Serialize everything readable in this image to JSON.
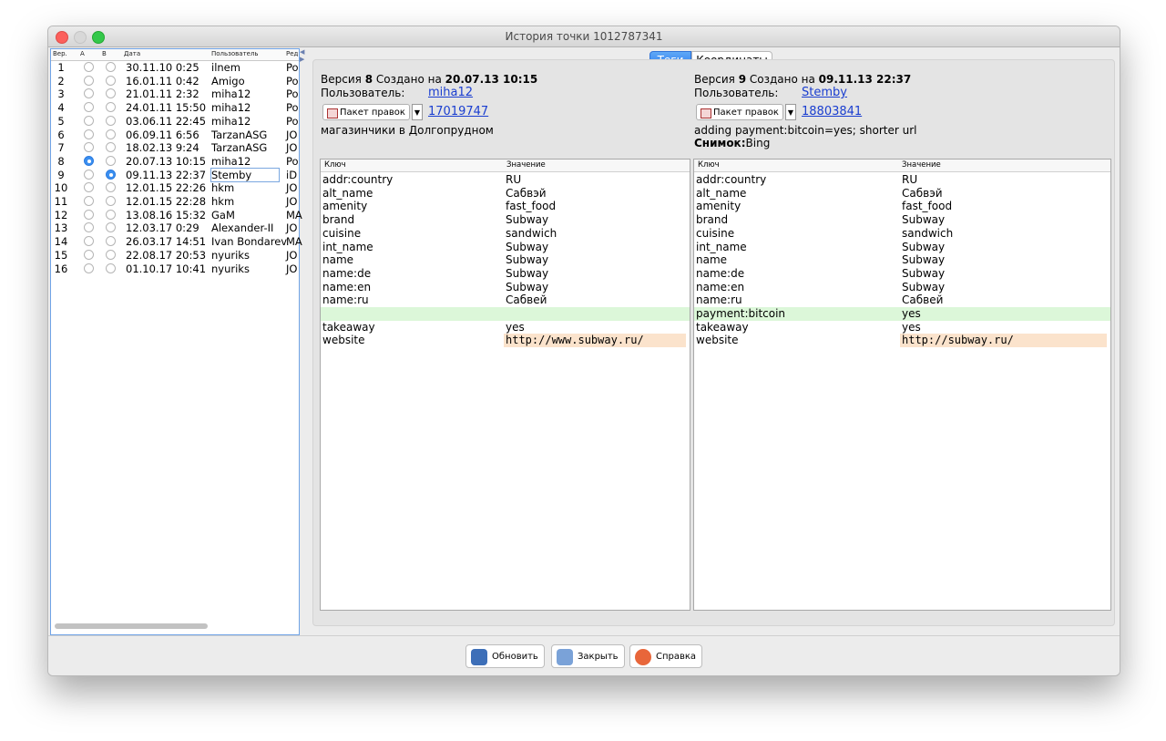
{
  "window": {
    "title": "История точки 1012787341"
  },
  "versions_table": {
    "headers": {
      "ver": "Вер.",
      "a": "A",
      "b": "B",
      "date": "Дата",
      "user": "Пользователь",
      "editor": "Ред"
    },
    "rows": [
      {
        "ver": "1",
        "a": false,
        "b": false,
        "date": "30.11.10 0:25",
        "user": "ilnem",
        "editor": "Po"
      },
      {
        "ver": "2",
        "a": false,
        "b": false,
        "date": "16.01.11 0:42",
        "user": "Amigo",
        "editor": "Po"
      },
      {
        "ver": "3",
        "a": false,
        "b": false,
        "date": "21.01.11 2:32",
        "user": "miha12",
        "editor": "Po"
      },
      {
        "ver": "4",
        "a": false,
        "b": false,
        "date": "24.01.11 15:50",
        "user": "miha12",
        "editor": "Po"
      },
      {
        "ver": "5",
        "a": false,
        "b": false,
        "date": "03.06.11 22:45",
        "user": "miha12",
        "editor": "Po"
      },
      {
        "ver": "6",
        "a": false,
        "b": false,
        "date": "06.09.11 6:56",
        "user": "TarzanASG",
        "editor": "JO"
      },
      {
        "ver": "7",
        "a": false,
        "b": false,
        "date": "18.02.13 9:24",
        "user": "TarzanASG",
        "editor": "JO"
      },
      {
        "ver": "8",
        "a": true,
        "b": false,
        "date": "20.07.13 10:15",
        "user": "miha12",
        "editor": "Po"
      },
      {
        "ver": "9",
        "a": false,
        "b": true,
        "date": "09.11.13 22:37",
        "user": "Stemby",
        "editor": "iD"
      },
      {
        "ver": "10",
        "a": false,
        "b": false,
        "date": "12.01.15 22:26",
        "user": "hkm",
        "editor": "JO"
      },
      {
        "ver": "11",
        "a": false,
        "b": false,
        "date": "12.01.15 22:28",
        "user": "hkm",
        "editor": "JO"
      },
      {
        "ver": "12",
        "a": false,
        "b": false,
        "date": "13.08.16 15:32",
        "user": "GaM",
        "editor": "MA"
      },
      {
        "ver": "13",
        "a": false,
        "b": false,
        "date": "12.03.17 0:29",
        "user": "Alexander-II",
        "editor": "JO"
      },
      {
        "ver": "14",
        "a": false,
        "b": false,
        "date": "26.03.17 14:51",
        "user": "Ivan Bondarev",
        "editor": "MA"
      },
      {
        "ver": "15",
        "a": false,
        "b": false,
        "date": "22.08.17 20:53",
        "user": "nyuriks",
        "editor": "JO"
      },
      {
        "ver": "16",
        "a": false,
        "b": false,
        "date": "01.10.17 10:41",
        "user": "nyuriks",
        "editor": "JO"
      }
    ]
  },
  "tabs": {
    "tags": "Теги",
    "coords": "Координаты"
  },
  "left_version": {
    "prefix": "Версия",
    "number": "8",
    "created": "Создано на",
    "datetime": "20.07.13 10:15",
    "user_label": "Пользователь:",
    "user": "miha12",
    "changeset_button": "Пакет правок",
    "changeset_id": "17019747",
    "comment": "магазинчики в Долгопрудном"
  },
  "right_version": {
    "prefix": "Версия",
    "number": "9",
    "created": "Создано на",
    "datetime": "09.11.13 22:37",
    "user_label": "Пользователь:",
    "user": "Stemby",
    "changeset_button": "Пакет правок",
    "changeset_id": "18803841",
    "comment": "adding payment:bitcoin=yes; shorter url",
    "imagery_label": "Снимок:",
    "imagery_value": "Bing"
  },
  "tag_headers": {
    "key": "Ключ",
    "value": "Значение"
  },
  "left_tags": [
    {
      "key": "addr:country",
      "value": "RU"
    },
    {
      "key": "alt_name",
      "value": "Сабвэй"
    },
    {
      "key": "amenity",
      "value": "fast_food"
    },
    {
      "key": "brand",
      "value": "Subway"
    },
    {
      "key": "cuisine",
      "value": "sandwich"
    },
    {
      "key": "int_name",
      "value": "Subway"
    },
    {
      "key": "name",
      "value": "Subway"
    },
    {
      "key": "name:de",
      "value": "Subway"
    },
    {
      "key": "name:en",
      "value": "Subway"
    },
    {
      "key": "name:ru",
      "value": "Сабвей"
    },
    {
      "key": "",
      "value": ""
    },
    {
      "key": "takeaway",
      "value": "yes"
    },
    {
      "key": "website",
      "value": "http://www.subway.ru/"
    }
  ],
  "right_tags": [
    {
      "key": "addr:country",
      "value": "RU"
    },
    {
      "key": "alt_name",
      "value": "Сабвэй"
    },
    {
      "key": "amenity",
      "value": "fast_food"
    },
    {
      "key": "brand",
      "value": "Subway"
    },
    {
      "key": "cuisine",
      "value": "sandwich"
    },
    {
      "key": "int_name",
      "value": "Subway"
    },
    {
      "key": "name",
      "value": "Subway"
    },
    {
      "key": "name:de",
      "value": "Subway"
    },
    {
      "key": "name:en",
      "value": "Subway"
    },
    {
      "key": "name:ru",
      "value": "Сабвей"
    },
    {
      "key": "payment:bitcoin",
      "value": "yes"
    },
    {
      "key": "takeaway",
      "value": "yes"
    },
    {
      "key": "website",
      "value": "http://subway.ru/"
    }
  ],
  "buttons": {
    "refresh": "Обновить",
    "close": "Закрыть",
    "help": "Справка"
  },
  "colors": {
    "accent": "#2f7ff0",
    "added_row": "#dcf7d9",
    "changed_value": "#fbe3cc",
    "link": "#1a3ed0"
  }
}
